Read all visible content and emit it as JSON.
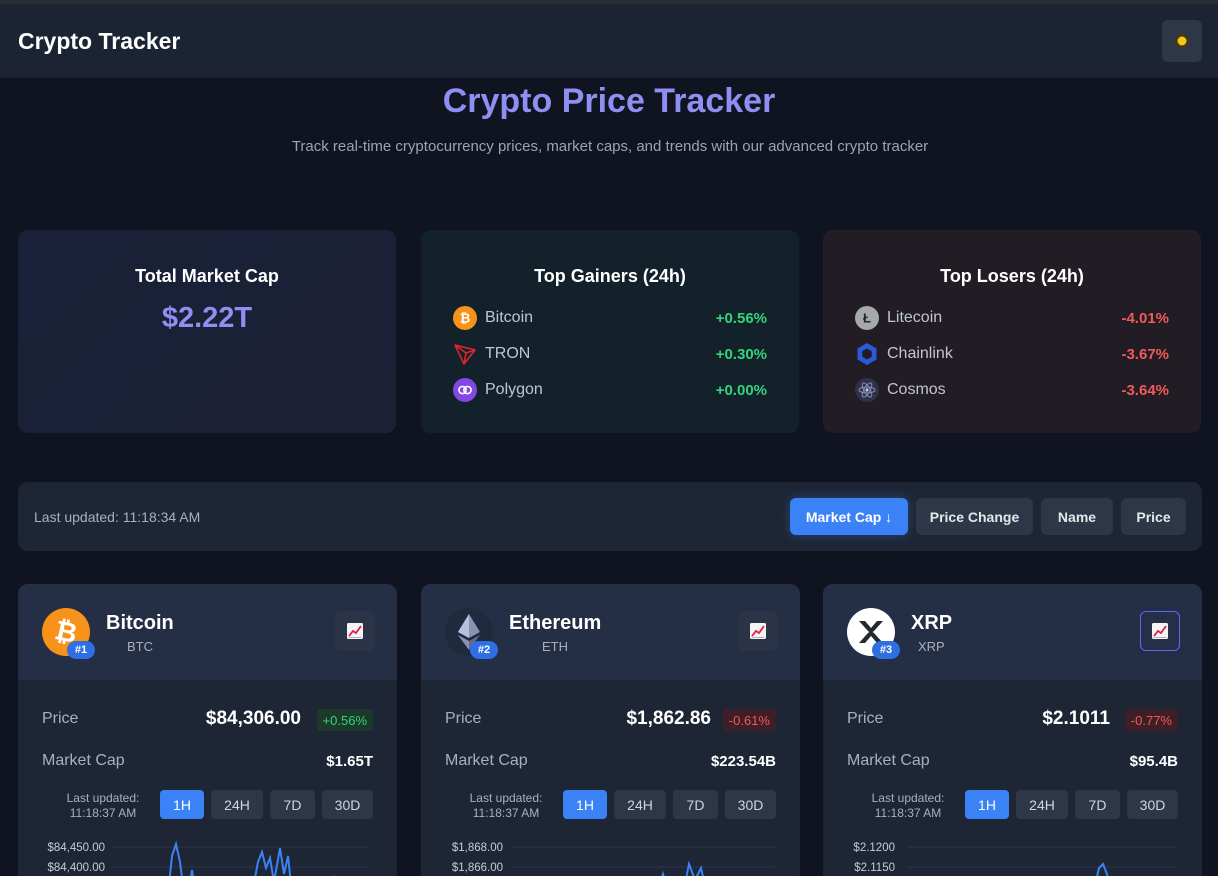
{
  "app": {
    "title": "Crypto Tracker",
    "theme_icon": "sun-icon"
  },
  "hero": {
    "title": "Crypto Price Tracker",
    "subtitle": "Track real-time cryptocurrency prices, market caps, and trends with our advanced crypto tracker"
  },
  "stats": {
    "market_cap": {
      "title": "Total Market Cap",
      "value": "$2.22T"
    },
    "gainers": {
      "title": "Top Gainers (24h)",
      "items": [
        {
          "name": "Bitcoin",
          "change": "+0.56%",
          "icon": "bitcoin-icon"
        },
        {
          "name": "TRON",
          "change": "+0.30%",
          "icon": "tron-icon"
        },
        {
          "name": "Polygon",
          "change": "+0.00%",
          "icon": "polygon-icon"
        }
      ]
    },
    "losers": {
      "title": "Top Losers (24h)",
      "items": [
        {
          "name": "Litecoin",
          "change": "-4.01%",
          "icon": "litecoin-icon"
        },
        {
          "name": "Chainlink",
          "change": "-3.67%",
          "icon": "chainlink-icon"
        },
        {
          "name": "Cosmos",
          "change": "-3.64%",
          "icon": "cosmos-icon"
        }
      ]
    }
  },
  "toolbar": {
    "last_updated": "Last updated: 11:18:34 AM",
    "sort_buttons": [
      {
        "label": "Market Cap ↓",
        "active": true
      },
      {
        "label": "Price Change",
        "active": false
      },
      {
        "label": "Name",
        "active": false
      },
      {
        "label": "Price",
        "active": false
      }
    ]
  },
  "coins": [
    {
      "name": "Bitcoin",
      "symbol": "BTC",
      "rank": "#1",
      "price_label": "Price",
      "price": "$84,306.00",
      "change": "+0.56%",
      "change_dir": "up",
      "mcap_label": "Market Cap",
      "market_cap": "$1.65T",
      "updated_label": "Last updated:",
      "updated_time": "11:18:37 AM",
      "timeframes": [
        "1H",
        "24H",
        "7D",
        "30D"
      ],
      "active_timeframe": "1H",
      "chart_toggle_icon": "chart-icon",
      "y_ticks": [
        "$84,450.00",
        "$84,400.00"
      ]
    },
    {
      "name": "Ethereum",
      "symbol": "ETH",
      "rank": "#2",
      "price_label": "Price",
      "price": "$1,862.86",
      "change": "-0.61%",
      "change_dir": "down",
      "mcap_label": "Market Cap",
      "market_cap": "$223.54B",
      "updated_label": "Last updated:",
      "updated_time": "11:18:37 AM",
      "timeframes": [
        "1H",
        "24H",
        "7D",
        "30D"
      ],
      "active_timeframe": "1H",
      "chart_toggle_icon": "chart-icon",
      "y_ticks": [
        "$1,868.00",
        "$1,866.00"
      ]
    },
    {
      "name": "XRP",
      "symbol": "XRP",
      "rank": "#3",
      "price_label": "Price",
      "price": "$2.1011",
      "change": "-0.77%",
      "change_dir": "down",
      "mcap_label": "Market Cap",
      "market_cap": "$95.4B",
      "updated_label": "Last updated:",
      "updated_time": "11:18:37 AM",
      "timeframes": [
        "1H",
        "24H",
        "7D",
        "30D"
      ],
      "active_timeframe": "1H",
      "chart_toggle_icon": "chart-icon",
      "y_ticks": [
        "$2.1200",
        "$2.1150"
      ]
    }
  ],
  "colors": {
    "accent": "#8f8ff3",
    "primary_button": "#3b82f6",
    "positive": "#34d37a",
    "negative": "#f05a5a"
  }
}
